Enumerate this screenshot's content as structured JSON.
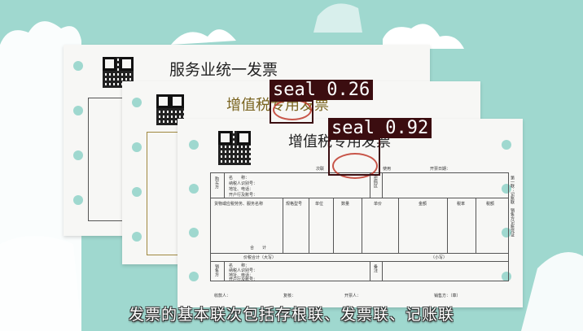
{
  "invoice_back": {
    "title": "服务业统一发票"
  },
  "invoice_middle": {
    "title": "增值税专用发票"
  },
  "invoice_front": {
    "title": "增值税专用发票",
    "header": {
      "copy": "次联",
      "use": "使用",
      "date": "开票日期："
    },
    "buyer_label": "购买方",
    "buyer_fields": [
      "名　　称：",
      "纳税人识别号：",
      "地址、电话：",
      "开户行及账号："
    ],
    "password_label": "密码区",
    "columns": [
      "货物或应税劳务、服务名称",
      "规格型号",
      "单位",
      "数量",
      "单价",
      "金额",
      "税率",
      "税额"
    ],
    "total": "合　　计",
    "total_tax_label": "价税合计（大写）",
    "small_label": "（小写）",
    "seller_label": "销售方",
    "seller_fields": [
      "名　　称：",
      "纳税人识别号：",
      "地址、电话：",
      "开户行及账号："
    ],
    "remark": "备注",
    "footer": [
      "收款人：",
      "复核：",
      "开票人：",
      "销售方：（章）"
    ],
    "side_text": "第一联：记账联　销售方记账凭证"
  },
  "detections": [
    {
      "label": "seal",
      "score": "0.26"
    },
    {
      "label": "seal",
      "score": "0.92"
    }
  ],
  "caption": "发票的基本联次包括存根联、发票联、记账联",
  "colors": {
    "background": "#9fd8cf",
    "cloud": "#ffffff",
    "box": "#3b0d10",
    "seal": "#c0392b"
  }
}
